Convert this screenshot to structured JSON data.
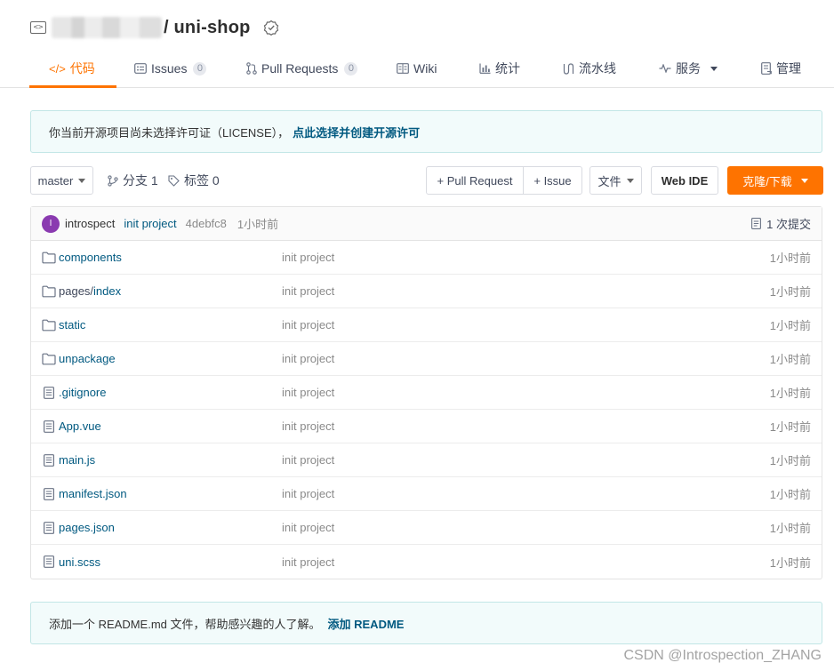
{
  "repo": {
    "name": "/ uni-shop"
  },
  "tabs": [
    {
      "icon": "</>",
      "label": "代码",
      "count": null
    },
    {
      "icon": "issues-icon",
      "label": "Issues",
      "count": "0"
    },
    {
      "icon": "pull-request-icon",
      "label": "Pull Requests",
      "count": "0"
    },
    {
      "icon": "wiki-icon",
      "label": "Wiki",
      "count": null
    },
    {
      "icon": "stats-icon",
      "label": "统计",
      "count": null
    },
    {
      "icon": "pipeline-icon",
      "label": "流水线",
      "count": null
    },
    {
      "icon": "service-icon",
      "label": "服务",
      "count": null
    },
    {
      "icon": "manage-icon",
      "label": "管理",
      "count": null
    }
  ],
  "license_notice": {
    "text": "你当前开源项目尚未选择许可证（LICENSE），",
    "action": "点此选择并创建开源许可"
  },
  "toolbar": {
    "branch": "master",
    "branches": "分支 1",
    "tags": "标签 0",
    "pull_request": "+ Pull Request",
    "issue": "+ Issue",
    "file": "文件",
    "web_ide": "Web IDE",
    "clone": "克隆/下载"
  },
  "commit": {
    "avatar_letter": "I",
    "author": "introspect",
    "message": "init project",
    "sha": "4debfc8",
    "time": "1小时前",
    "total": "1 次提交"
  },
  "files": [
    {
      "type": "folder",
      "name": "components",
      "dir": "",
      "message": "init project",
      "time": "1小时前"
    },
    {
      "type": "folder",
      "name": "index",
      "dir": "pages/",
      "message": "init project",
      "time": "1小时前"
    },
    {
      "type": "folder",
      "name": "static",
      "dir": "",
      "message": "init project",
      "time": "1小时前"
    },
    {
      "type": "folder",
      "name": "unpackage",
      "dir": "",
      "message": "init project",
      "time": "1小时前"
    },
    {
      "type": "file",
      "name": ".gitignore",
      "dir": "",
      "message": "init project",
      "time": "1小时前"
    },
    {
      "type": "file",
      "name": "App.vue",
      "dir": "",
      "message": "init project",
      "time": "1小时前"
    },
    {
      "type": "file",
      "name": "main.js",
      "dir": "",
      "message": "init project",
      "time": "1小时前"
    },
    {
      "type": "file",
      "name": "manifest.json",
      "dir": "",
      "message": "init project",
      "time": "1小时前"
    },
    {
      "type": "file",
      "name": "pages.json",
      "dir": "",
      "message": "init project",
      "time": "1小时前"
    },
    {
      "type": "file",
      "name": "uni.scss",
      "dir": "",
      "message": "init project",
      "time": "1小时前"
    }
  ],
  "readme_notice": {
    "text": "添加一个 README.md 文件，帮助感兴趣的人了解。",
    "action": "添加 README"
  },
  "watermark": "CSDN @Introspection_ZHANG",
  "colors": {
    "accent": "#fe7300",
    "link": "#005980",
    "notice_bg": "#f2fbfb"
  }
}
